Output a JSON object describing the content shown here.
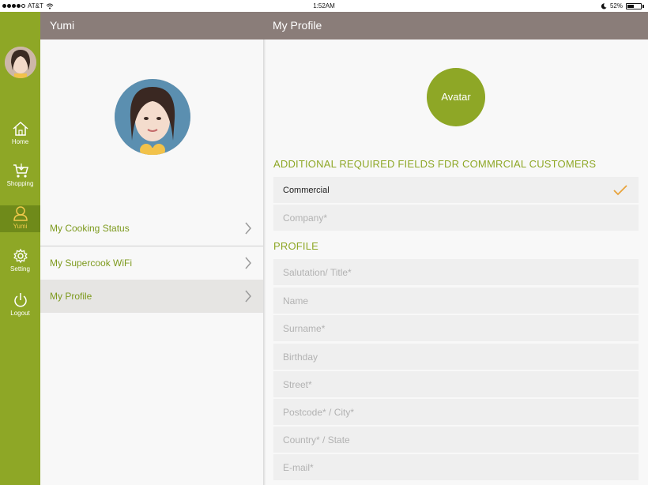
{
  "status_bar": {
    "carrier": "AT&T",
    "time": "1:52AM",
    "battery": "52%",
    "battery_level": 0.52
  },
  "sidebar": {
    "items": [
      {
        "label": "Home",
        "icon": "home-icon"
      },
      {
        "label": "Shopping",
        "icon": "cart-icon"
      },
      {
        "label": "Yumi",
        "icon": "user-icon",
        "active": true
      },
      {
        "label": "Setting",
        "icon": "gear-icon"
      },
      {
        "label": "Logout",
        "icon": "power-icon"
      }
    ]
  },
  "left_panel": {
    "title": "Yumi",
    "menu": [
      {
        "label": "My Cooking Status"
      },
      {
        "label": "My Supercook WiFi"
      },
      {
        "label": "My Profile",
        "selected": true
      }
    ]
  },
  "right_panel": {
    "title": "My Profile",
    "avatar_label": "Avatar",
    "additional_section_title": "ADDITIONAL REQUIRED FIELDS FDR COMMRCIAL CUSTOMERS",
    "commercial_label": "Commercial",
    "company_placeholder": "Company*",
    "profile_section_title": "PROFILE",
    "profile_fields": [
      "Salutation/ Title*",
      "Name",
      "Surname*",
      "Birthday",
      "Street*",
      "Postcode* / City*",
      "Country* / State",
      "E-mail*"
    ]
  },
  "colors": {
    "accent_green": "#8ea726",
    "active_nav": "#6f8a1a",
    "header_brown": "#8a7d79",
    "active_label_gold": "#f2c94c",
    "check_color": "#e8a33b"
  }
}
